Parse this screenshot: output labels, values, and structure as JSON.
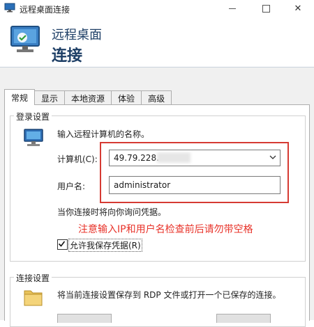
{
  "window": {
    "title": "远程桌面连接",
    "min_label": "—",
    "close_label": "✕"
  },
  "banner": {
    "line1": "远程桌面",
    "line2": "连接"
  },
  "tabs": [
    {
      "label": "常规"
    },
    {
      "label": "显示"
    },
    {
      "label": "本地资源"
    },
    {
      "label": "体验"
    },
    {
      "label": "高级"
    }
  ],
  "login": {
    "group_label": "登录设置",
    "prompt": "输入远程计算机的名称。",
    "computer_label": "计算机(C):",
    "computer_value": "49.79.228.",
    "user_label": "用户名:",
    "user_value": "administrator",
    "note": "当你连接时将向你询问凭据。",
    "warning": "注意输入IP和用户名检查前后请勿带空格",
    "save_credentials_label": "允许我保存凭据(R)",
    "save_credentials_checked": true
  },
  "connection": {
    "group_label": "连接设置",
    "description": "将当前连接设置保存到 RDP 文件或打开一个已保存的连接。"
  },
  "colors": {
    "accent_dark": "#1e3f66",
    "warning_red": "#e8332a",
    "highlight_box": "#d63a33"
  }
}
